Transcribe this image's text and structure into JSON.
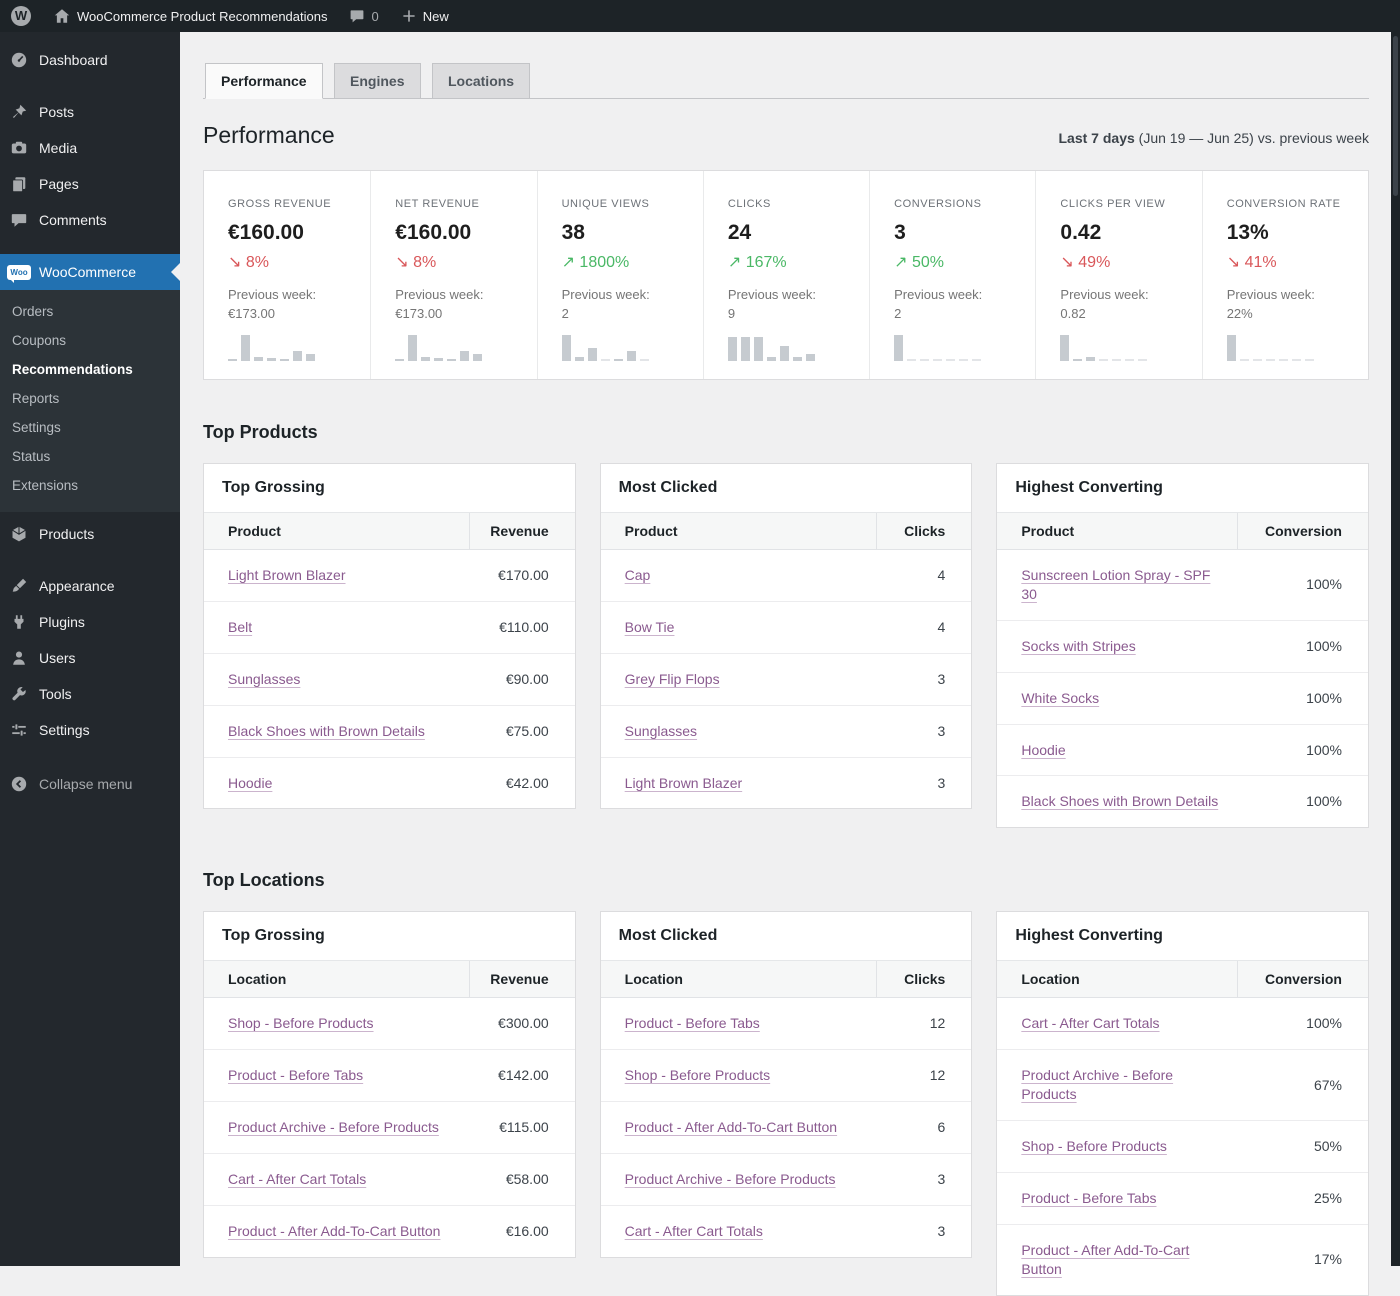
{
  "colors": {
    "accent_blue": "#2271b1",
    "link_purple": "#8a5a8f",
    "positive_green": "#4ab866",
    "negative_red": "#d9575a"
  },
  "admin_bar": {
    "site_name": "WooCommerce Product Recommendations",
    "comments_count": "0",
    "new_label": "New"
  },
  "sidebar": {
    "top": [
      {
        "label": "Dashboard"
      },
      {
        "label": "Posts"
      },
      {
        "label": "Media"
      },
      {
        "label": "Pages"
      },
      {
        "label": "Comments"
      }
    ],
    "woocommerce": {
      "label": "WooCommerce",
      "submenu": [
        {
          "label": "Orders"
        },
        {
          "label": "Coupons"
        },
        {
          "label": "Recommendations",
          "current": true
        },
        {
          "label": "Reports"
        },
        {
          "label": "Settings"
        },
        {
          "label": "Status"
        },
        {
          "label": "Extensions"
        }
      ]
    },
    "bottom": [
      {
        "label": "Products"
      },
      {
        "label": "Appearance"
      },
      {
        "label": "Plugins"
      },
      {
        "label": "Users"
      },
      {
        "label": "Tools"
      },
      {
        "label": "Settings"
      }
    ],
    "collapse_label": "Collapse menu"
  },
  "tabs": [
    {
      "label": "Performance",
      "active": true
    },
    {
      "label": "Engines",
      "active": false
    },
    {
      "label": "Locations",
      "active": false
    }
  ],
  "page": {
    "title": "Performance",
    "period_bold": "Last 7 days",
    "period_rest": " (Jun 19 — Jun 25) vs. previous week"
  },
  "kpis": [
    {
      "label": "GROSS REVENUE",
      "value": "€160.00",
      "arrow": "↘",
      "change": "8%",
      "direction": "down",
      "prev_label": "Previous week:",
      "prev_value": "€173.00",
      "spark": [
        0.07,
        1,
        0.14,
        0.12,
        0.07,
        0.4,
        0.26
      ]
    },
    {
      "label": "NET REVENUE",
      "value": "€160.00",
      "arrow": "↘",
      "change": "8%",
      "direction": "down",
      "prev_label": "Previous week:",
      "prev_value": "€173.00",
      "spark": [
        0.07,
        1,
        0.14,
        0.12,
        0.07,
        0.4,
        0.26
      ]
    },
    {
      "label": "UNIQUE VIEWS",
      "value": "38",
      "arrow": "↗",
      "change": "1800%",
      "direction": "up",
      "prev_label": "Previous week:",
      "prev_value": "2",
      "spark": [
        1,
        0.15,
        0.5,
        0.03,
        0.06,
        0.38,
        0.03
      ]
    },
    {
      "label": "CLICKS",
      "value": "24",
      "arrow": "↗",
      "change": "167%",
      "direction": "up",
      "prev_label": "Previous week:",
      "prev_value": "9",
      "spark": [
        0.92,
        0.92,
        0.92,
        0.16,
        0.56,
        0.16,
        0.28
      ]
    },
    {
      "label": "CONVERSIONS",
      "value": "3",
      "arrow": "↗",
      "change": "50%",
      "direction": "up",
      "prev_label": "Previous week:",
      "prev_value": "2",
      "spark": [
        1,
        0.03,
        0.03,
        0.03,
        0.03,
        0.03,
        0.03
      ]
    },
    {
      "label": "CLICKS PER VIEW",
      "value": "0.42",
      "arrow": "↘",
      "change": "49%",
      "direction": "down",
      "prev_label": "Previous week:",
      "prev_value": "0.82",
      "spark": [
        1,
        0.07,
        0.16,
        0.03,
        0.03,
        0.03,
        0.03
      ]
    },
    {
      "label": "CONVERSION RATE",
      "value": "13%",
      "arrow": "↘",
      "change": "41%",
      "direction": "down",
      "prev_label": "Previous week:",
      "prev_value": "22%",
      "spark": [
        1,
        0.03,
        0.03,
        0.03,
        0.03,
        0.03,
        0.03
      ]
    }
  ],
  "top_products": {
    "heading": "Top Products",
    "grossing": {
      "title": "Top Grossing",
      "name_header": "Product",
      "value_header": "Revenue",
      "rows": [
        {
          "name": "Light Brown Blazer",
          "value": "€170.00"
        },
        {
          "name": "Belt",
          "value": "€110.00"
        },
        {
          "name": "Sunglasses",
          "value": "€90.00"
        },
        {
          "name": "Black Shoes with Brown Details",
          "value": "€75.00"
        },
        {
          "name": "Hoodie",
          "value": "€42.00"
        }
      ]
    },
    "clicked": {
      "title": "Most Clicked",
      "name_header": "Product",
      "value_header": "Clicks",
      "rows": [
        {
          "name": "Cap",
          "value": "4"
        },
        {
          "name": "Bow Tie",
          "value": "4"
        },
        {
          "name": "Grey Flip Flops",
          "value": "3"
        },
        {
          "name": "Sunglasses",
          "value": "3"
        },
        {
          "name": "Light Brown Blazer",
          "value": "3"
        }
      ]
    },
    "converting": {
      "title": "Highest Converting",
      "name_header": "Product",
      "value_header": "Conversion",
      "rows": [
        {
          "name": "Sunscreen Lotion Spray - SPF 30",
          "value": "100%"
        },
        {
          "name": "Socks with Stripes",
          "value": "100%"
        },
        {
          "name": "White Socks",
          "value": "100%"
        },
        {
          "name": "Hoodie",
          "value": "100%"
        },
        {
          "name": "Black Shoes with Brown Details",
          "value": "100%"
        }
      ]
    }
  },
  "top_locations": {
    "heading": "Top Locations",
    "grossing": {
      "title": "Top Grossing",
      "name_header": "Location",
      "value_header": "Revenue",
      "rows": [
        {
          "name": "Shop - Before Products",
          "value": "€300.00"
        },
        {
          "name": "Product - Before Tabs",
          "value": "€142.00"
        },
        {
          "name": "Product Archive - Before Products",
          "value": "€115.00"
        },
        {
          "name": "Cart - After Cart Totals",
          "value": "€58.00"
        },
        {
          "name": "Product - After Add-To-Cart Button",
          "value": "€16.00"
        }
      ]
    },
    "clicked": {
      "title": "Most Clicked",
      "name_header": "Location",
      "value_header": "Clicks",
      "rows": [
        {
          "name": "Product - Before Tabs",
          "value": "12"
        },
        {
          "name": "Shop - Before Products",
          "value": "12"
        },
        {
          "name": "Product - After Add-To-Cart Button",
          "value": "6"
        },
        {
          "name": "Product Archive - Before Products",
          "value": "3"
        },
        {
          "name": "Cart - After Cart Totals",
          "value": "3"
        }
      ]
    },
    "converting": {
      "title": "Highest Converting",
      "name_header": "Location",
      "value_header": "Conversion",
      "rows": [
        {
          "name": "Cart - After Cart Totals",
          "value": "100%"
        },
        {
          "name": "Product Archive - Before Products",
          "value": "67%"
        },
        {
          "name": "Shop - Before Products",
          "value": "50%"
        },
        {
          "name": "Product - Before Tabs",
          "value": "25%"
        },
        {
          "name": "Product - After Add-To-Cart Button",
          "value": "17%"
        }
      ]
    }
  }
}
